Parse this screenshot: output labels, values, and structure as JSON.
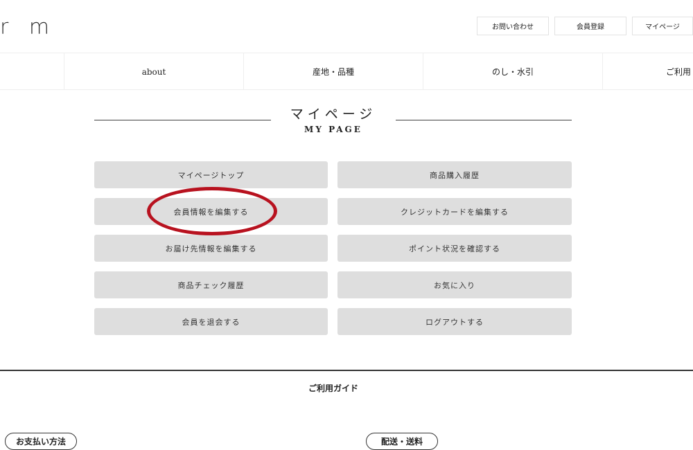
{
  "header": {
    "logo": "r m",
    "links": [
      "お問い合わせ",
      "会員登録",
      "マイページ"
    ]
  },
  "nav": [
    "about",
    "産地・品種",
    "のし・水引",
    "ご利用"
  ],
  "page": {
    "title": "マイページ",
    "subtitle": "MY PAGE"
  },
  "menu": {
    "left": [
      "マイページトップ",
      "会員情報を編集する",
      "お届け先情報を編集する",
      "商品チェック履歴",
      "会員を退会する"
    ],
    "right": [
      "商品購入履歴",
      "クレジットカードを編集する",
      "ポイント状況を確認する",
      "お気に入り",
      "ログアウトする"
    ]
  },
  "highlight": {
    "color": "#b8121f",
    "target": "会員情報を編集する"
  },
  "guide": {
    "title": "ご利用ガイド",
    "links": [
      "お支払い方法",
      "配送・送料"
    ]
  }
}
